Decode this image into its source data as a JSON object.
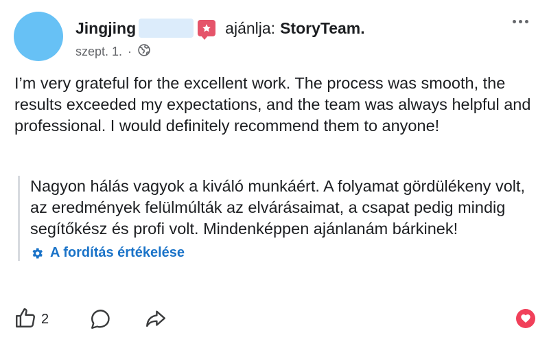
{
  "post": {
    "author": "Jingjing",
    "recommends_text": "ajánlja:",
    "page_name": "StoryTeam.",
    "date": "szept. 1.",
    "separator": "·",
    "body": "I’m very grateful for the excellent work. The process was smooth, the results exceeded my expectations, and the team was always helpful and professional. I would definitely recommend them to anyone!",
    "translation": "Nagyon hálás vagyok a kiváló munkáért. A folyamat gördülékeny volt, az eredmények felülmúlták az elvárásaimat, a csapat pedig mindig segítőkész és profi volt. Mindenképpen ajánlanám bárkinek!",
    "rate_translation_label": "A fordítás értékelése"
  },
  "actions": {
    "like_count": "2"
  },
  "icons": {
    "avatar": "avatar",
    "recommend": "recommend-flag-icon",
    "privacy": "globe-icon",
    "more": "more-dots-icon",
    "settings": "gear-icon",
    "like": "thumbs-up-icon",
    "comment": "comment-icon",
    "share": "share-icon",
    "reaction": "heart-reaction-icon"
  },
  "colors": {
    "avatar": "#67c1f5",
    "recommend_badge": "#e5546a",
    "link_blue": "#1a73c8",
    "reaction_red": "#f1405a"
  }
}
